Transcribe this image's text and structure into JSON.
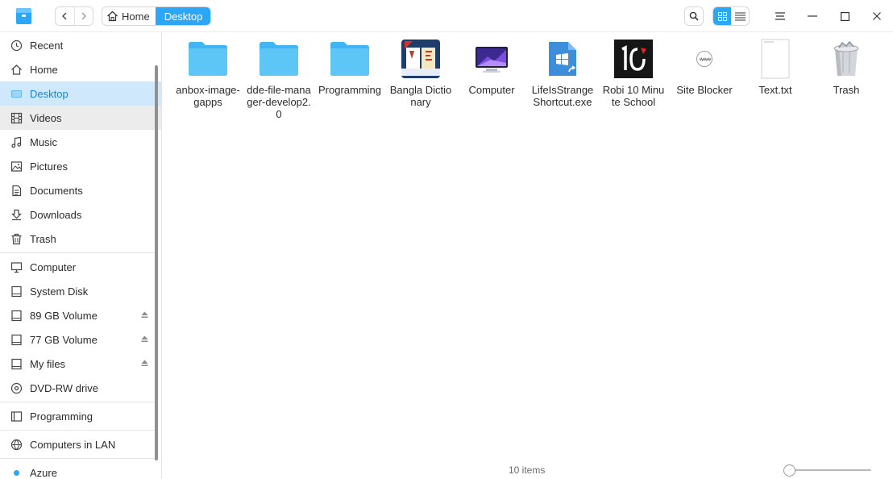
{
  "titlebar": {
    "breadcrumb": [
      {
        "label": "Home"
      },
      {
        "label": "Desktop"
      }
    ]
  },
  "sidebar": {
    "items": [
      {
        "label": "Recent",
        "icon": "clock-icon"
      },
      {
        "label": "Home",
        "icon": "home-icon"
      },
      {
        "label": "Desktop",
        "icon": "desktop-icon",
        "selected": true
      },
      {
        "label": "Videos",
        "icon": "film-icon"
      },
      {
        "label": "Music",
        "icon": "music-note-icon"
      },
      {
        "label": "Pictures",
        "icon": "picture-icon"
      },
      {
        "label": "Documents",
        "icon": "document-icon"
      },
      {
        "label": "Downloads",
        "icon": "download-icon"
      },
      {
        "label": "Trash",
        "icon": "trash-icon"
      },
      {
        "label": "Computer",
        "icon": "monitor-icon"
      },
      {
        "label": "System Disk",
        "icon": "disk-icon"
      },
      {
        "label": "89 GB Volume",
        "icon": "disk-icon",
        "ejectable": true
      },
      {
        "label": "77 GB Volume",
        "icon": "disk-icon",
        "ejectable": true
      },
      {
        "label": "My files",
        "icon": "disk-icon",
        "ejectable": true
      },
      {
        "label": "DVD-RW drive",
        "icon": "optical-disc-icon"
      },
      {
        "label": "Programming",
        "icon": "bookmark-icon"
      },
      {
        "label": "Computers in LAN",
        "icon": "network-icon"
      },
      {
        "label": "Azure",
        "icon": "dot-icon"
      }
    ]
  },
  "files": [
    {
      "name": "anbox-image-gapps",
      "icon": "folder-icon"
    },
    {
      "name": "dde-file-manager-develop2.0",
      "icon": "folder-icon"
    },
    {
      "name": "Programming",
      "icon": "folder-icon"
    },
    {
      "name": "Bangla Dictionary",
      "icon": "dictionary-app-icon"
    },
    {
      "name": "Computer",
      "icon": "computer-icon"
    },
    {
      "name": "LifeIsStrange Shortcut.exe",
      "icon": "windows-exe-icon"
    },
    {
      "name": "Robi 10 Minute School",
      "icon": "robi-10ms-icon"
    },
    {
      "name": "Site Blocker",
      "icon": "www-icon"
    },
    {
      "name": "Text.txt",
      "icon": "text-file-icon"
    },
    {
      "name": "Trash",
      "icon": "trash-bin-icon"
    }
  ],
  "status": {
    "item_count": "10 items"
  },
  "zoom": {
    "level_fraction": 0.0
  },
  "colors": {
    "accent": "#2ca7f8",
    "folder": "#5ec6f7",
    "selected_bg": "#cfe8fb"
  }
}
